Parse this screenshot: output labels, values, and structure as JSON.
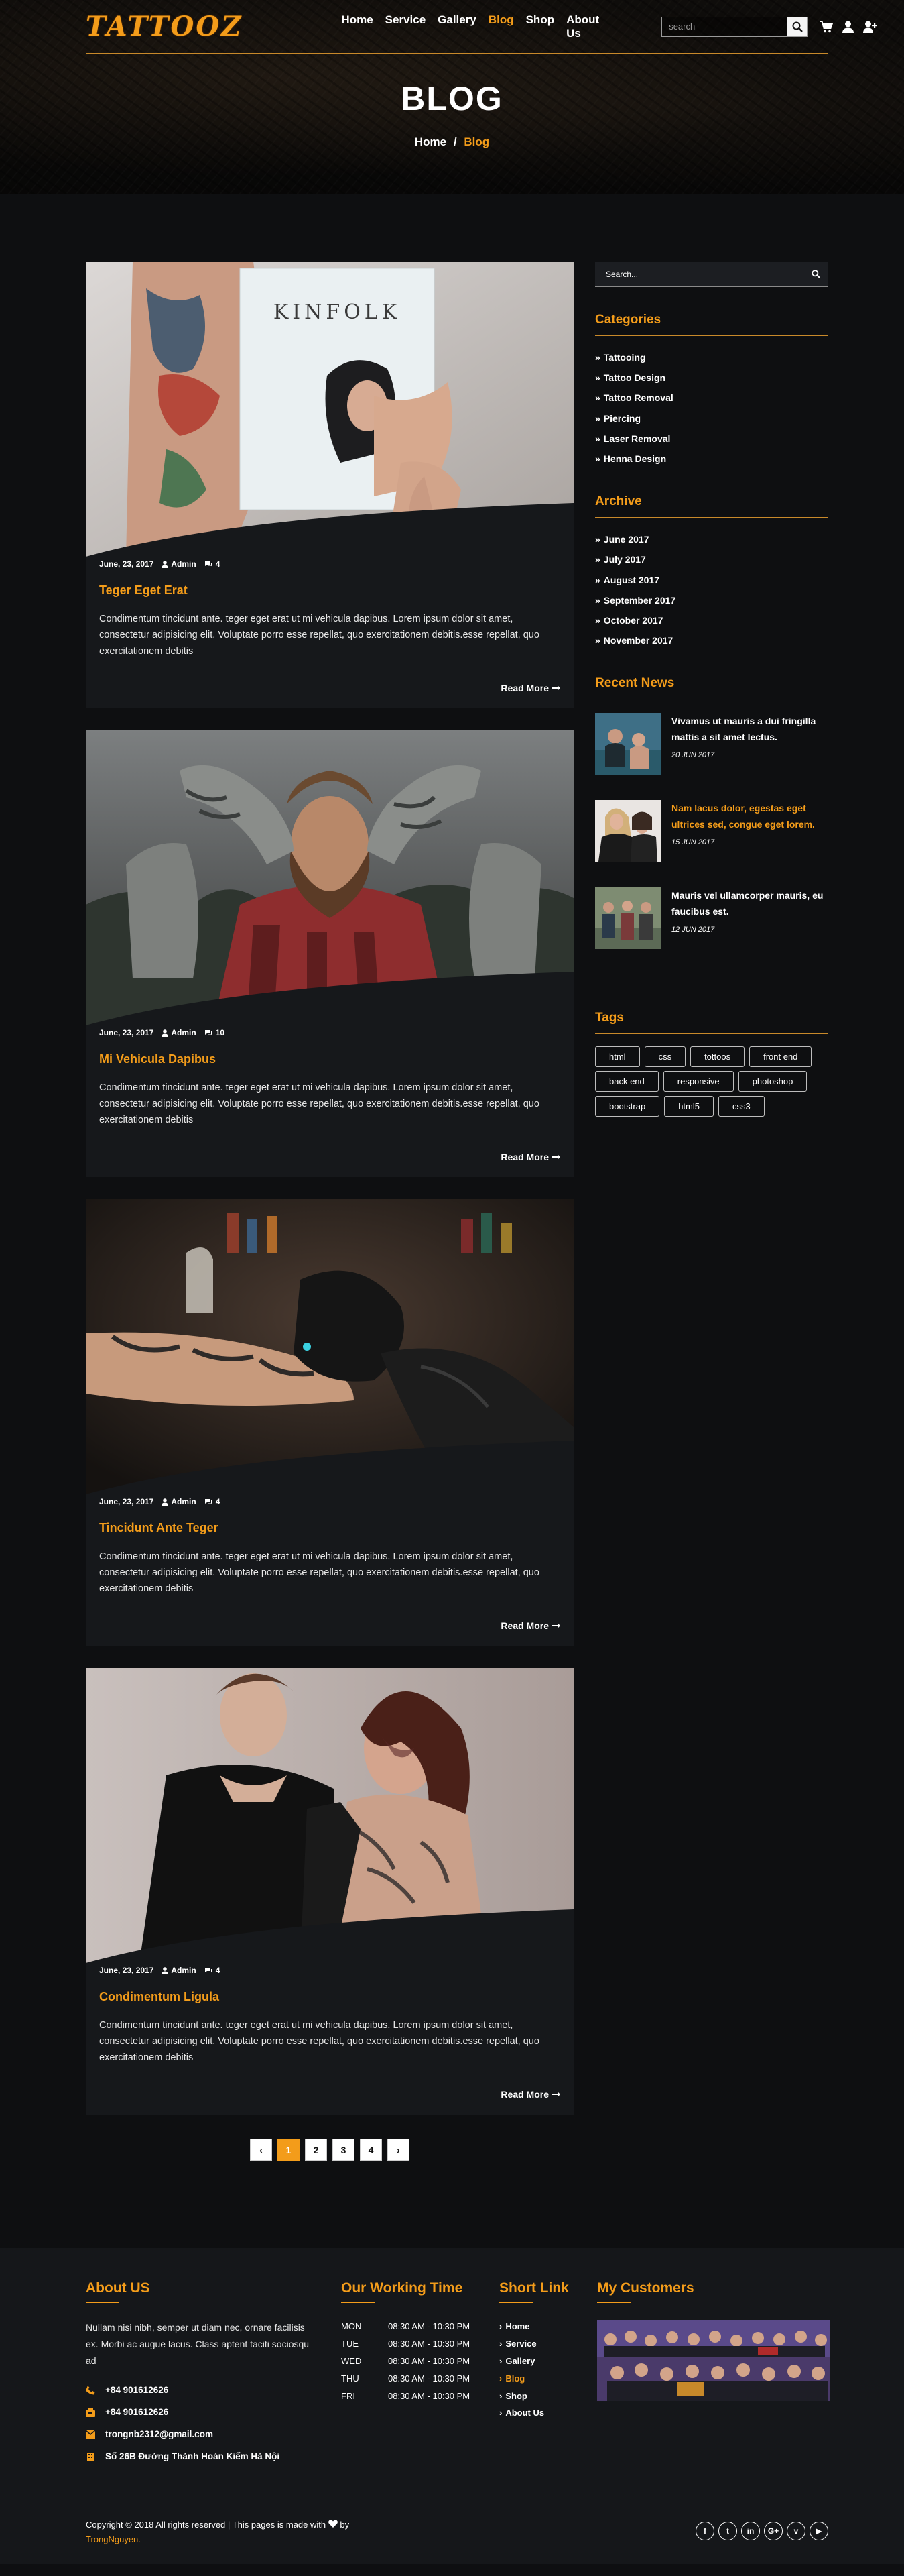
{
  "header": {
    "logo": "TATTOOZ",
    "nav": [
      "Home",
      "Service",
      "Gallery",
      "Blog",
      "Shop",
      "About Us"
    ],
    "active_nav": "Blog",
    "search_placeholder": "search",
    "icons": [
      "search-icon",
      "cart-icon",
      "user-icon",
      "user-plus-icon"
    ]
  },
  "hero": {
    "title": "BLOG",
    "breadcrumb_home": "Home",
    "breadcrumb_sep": "/",
    "breadcrumb_current": "Blog"
  },
  "posts": [
    {
      "date": "June, 23, 2017",
      "author": "Admin",
      "comments": "4",
      "title": "Teger Eget Erat",
      "excerpt": "Condimentum tincidunt ante. teger eget erat ut mi vehicula dapibus. Lorem ipsum dolor sit amet, consectetur adipisicing elit. Voluptate porro esse repellat, quo exercitationem debitis.esse repellat, quo exercitationem debitis",
      "read_more": "Read More"
    },
    {
      "date": "June, 23, 2017",
      "author": "Admin",
      "comments": "10",
      "title": "Mi Vehicula Dapibus",
      "excerpt": "Condimentum tincidunt ante. teger eget erat ut mi vehicula dapibus. Lorem ipsum dolor sit amet, consectetur adipisicing elit. Voluptate porro esse repellat, quo exercitationem debitis.esse repellat, quo exercitationem debitis",
      "read_more": "Read More"
    },
    {
      "date": "June, 23, 2017",
      "author": "Admin",
      "comments": "4",
      "title": "Tincidunt Ante Teger",
      "excerpt": "Condimentum tincidunt ante. teger eget erat ut mi vehicula dapibus. Lorem ipsum dolor sit amet, consectetur adipisicing elit. Voluptate porro esse repellat, quo exercitationem debitis.esse repellat, quo exercitationem debitis",
      "read_more": "Read More"
    },
    {
      "date": "June, 23, 2017",
      "author": "Admin",
      "comments": "4",
      "title": "Condimentum Ligula",
      "excerpt": "Condimentum tincidunt ante. teger eget erat ut mi vehicula dapibus. Lorem ipsum dolor sit amet, consectetur adipisicing elit. Voluptate porro esse repellat, quo exercitationem debitis.esse repellat, quo exercitationem debitis",
      "read_more": "Read More"
    }
  ],
  "kinfolk_label": "KINFOLK",
  "pagination": {
    "prev": "‹",
    "pages": [
      "1",
      "2",
      "3",
      "4"
    ],
    "active": "1",
    "next": "›"
  },
  "sidebar": {
    "search_placeholder": "Search...",
    "categories_title": "Categories",
    "categories": [
      "Tattooing",
      "Tattoo Design",
      "Tattoo Removal",
      "Piercing",
      "Laser Removal",
      "Henna Design"
    ],
    "archive_title": "Archive",
    "archive": [
      "June 2017",
      "July 2017",
      "August 2017",
      "September 2017",
      "October 2017",
      "November 2017"
    ],
    "recent_title": "Recent News",
    "recent": [
      {
        "title": "Vivamus ut mauris a dui fringilla mattis a sit amet lectus.",
        "date": "20 JUN 2017"
      },
      {
        "title": "Nam lacus dolor, egestas eget ultrices sed, congue eget lorem.",
        "date": "15 JUN 2017"
      },
      {
        "title": "Mauris vel ullamcorper mauris, eu faucibus est.",
        "date": "12 JUN 2017"
      }
    ],
    "tags_title": "Tags",
    "tags": [
      "html",
      "css",
      "tottoos",
      "front end",
      "back end",
      "responsive",
      "photoshop",
      "bootstrap",
      "html5",
      "css3"
    ]
  },
  "footer": {
    "about_title": "About US",
    "about_text": "Nullam nisi nibh, semper ut diam nec, ornare facilisis ex. Morbi ac augue lacus. Class aptent taciti sociosqu ad",
    "phone1": "+84 901612626",
    "phone2": "+84 901612626",
    "email": "trongnb2312@gmail.com",
    "address": "Số 26B Đường Thành Hoàn Kiếm Hà Nội",
    "hours_title": "Our Working Time",
    "hours": [
      {
        "day": "MON",
        "time": "08:30 AM - 10:30 PM"
      },
      {
        "day": "TUE",
        "time": "08:30 AM - 10:30 PM"
      },
      {
        "day": "WED",
        "time": "08:30 AM - 10:30 PM"
      },
      {
        "day": "THU",
        "time": "08:30 AM - 10:30 PM"
      },
      {
        "day": "FRI",
        "time": "08:30 AM - 10:30 PM"
      }
    ],
    "links_title": "Short Link",
    "links": [
      "Home",
      "Service",
      "Gallery",
      "Blog",
      "Shop",
      "About Us"
    ],
    "active_link": "Blog",
    "customers_title": "My Customers",
    "copyright": "Copyright © 2018 All rights reserved | This pages is made with",
    "copyright_by": "by",
    "author": "TrongNguyen.",
    "socials": [
      "facebook-icon",
      "twitter-icon",
      "linkedin-icon",
      "google-plus-icon",
      "vine-icon",
      "youtube-icon"
    ],
    "social_glyphs": [
      "f",
      "t",
      "in",
      "G+",
      "v",
      "▶"
    ]
  },
  "colors": {
    "accent": "#f39c1a",
    "background": "#0e0f11",
    "card": "#16181b"
  }
}
